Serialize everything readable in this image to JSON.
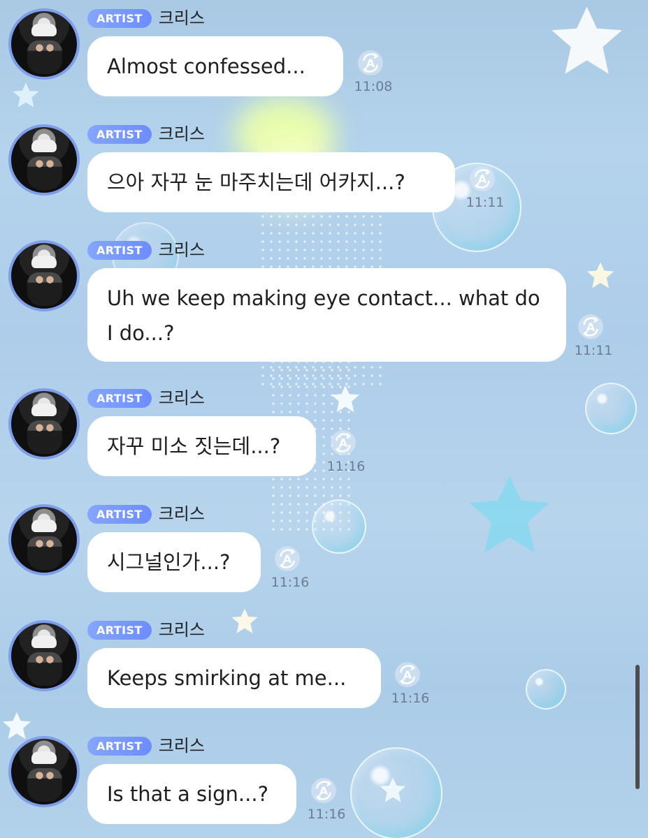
{
  "chat": {
    "messages": [
      {
        "badge": "ARTIST",
        "name": "크리스",
        "text": "Almost confessed...",
        "time": "11:08"
      },
      {
        "badge": "ARTIST",
        "name": "크리스",
        "text": "으아 자꾸 눈 마주치는데 어카지...?",
        "time": "11:11"
      },
      {
        "badge": "ARTIST",
        "name": "크리스",
        "text": "Uh we keep making eye contact... what do I do...?",
        "time": "11:11"
      },
      {
        "badge": "ARTIST",
        "name": "크리스",
        "text": "자꾸 미소 짓는데...?",
        "time": "11:16"
      },
      {
        "badge": "ARTIST",
        "name": "크리스",
        "text": "시그널인가...?",
        "time": "11:16"
      },
      {
        "badge": "ARTIST",
        "name": "크리스",
        "text": "Keeps smirking at me...",
        "time": "11:16"
      },
      {
        "badge": "ARTIST",
        "name": "크리스",
        "text": "Is that a sign...?",
        "time": "11:16"
      }
    ]
  },
  "colors": {
    "background": "#b2d1ea",
    "badge": "#6d8cff",
    "avatar_ring": "#7f9eea",
    "message_bubble": "#ffffff",
    "time_text": "#6c7d93"
  },
  "icons": {
    "translate": "translate-icon"
  }
}
